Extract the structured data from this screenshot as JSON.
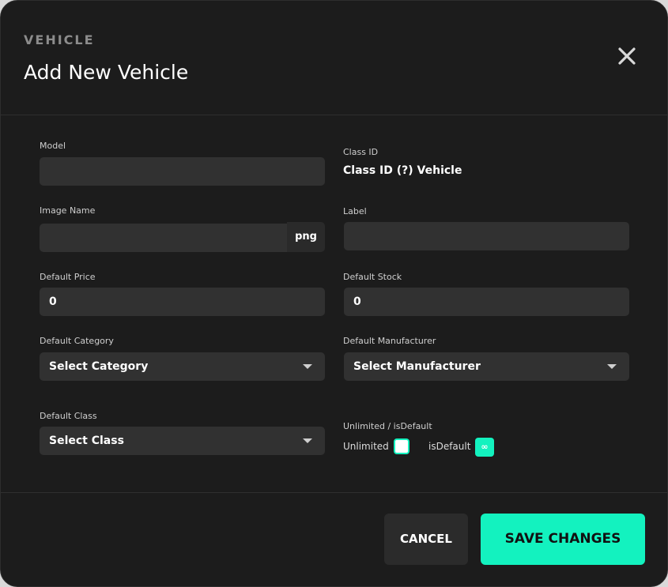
{
  "header": {
    "eyebrow": "VEHICLE",
    "title": "Add New Vehicle"
  },
  "form": {
    "model": {
      "label": "Model",
      "value": ""
    },
    "class_id": {
      "label": "Class ID",
      "value": "Class ID (?) Vehicle"
    },
    "image_name": {
      "label": "Image Name",
      "value": "",
      "suffix": "png"
    },
    "label": {
      "label": "Label",
      "value": ""
    },
    "default_price": {
      "label": "Default Price",
      "value": "0"
    },
    "default_stock": {
      "label": "Default Stock",
      "value": "0"
    },
    "default_category": {
      "label": "Default Category",
      "selected": "Select Category"
    },
    "default_manufacturer": {
      "label": "Default Manufacturer",
      "selected": "Select Manufacturer"
    },
    "default_class": {
      "label": "Default Class",
      "selected": "Select Class"
    },
    "unlimited_isdefault": {
      "label": "Unlimited / isDefault",
      "unlimited_label": "Unlimited",
      "isdefault_label": "isDefault",
      "isdefault_glyph": "∞"
    }
  },
  "footer": {
    "cancel_label": "CANCEL",
    "save_label": "SAVE CHANGES"
  },
  "colors": {
    "accent": "#13f2bf",
    "background": "#1c1c1c",
    "field": "#313131"
  }
}
